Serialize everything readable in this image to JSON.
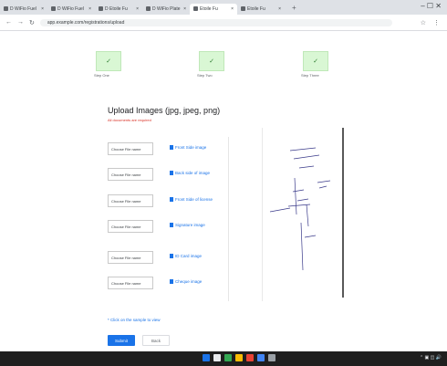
{
  "browser": {
    "tabs": [
      {
        "title": "D WiFio Fuel",
        "active": false
      },
      {
        "title": "D WiFio Fuel",
        "active": false
      },
      {
        "title": "D Etoile Fu",
        "active": false
      },
      {
        "title": "D WiFio Plate Fu",
        "active": false
      },
      {
        "title": "Etoile Fu",
        "active": true
      },
      {
        "title": "Etoile Fu",
        "active": false
      }
    ],
    "new_tab": "+",
    "window_controls": "– ☐ ✕",
    "url": "app.example.com/registrations/upload",
    "nav": {
      "back": "←",
      "forward": "→",
      "reload": "↻"
    }
  },
  "stepper": {
    "steps": [
      {
        "check": "✓",
        "label": "Step One"
      },
      {
        "check": "✓",
        "label": "Step Two"
      },
      {
        "check": "✓",
        "label": "Step Three"
      }
    ]
  },
  "upload": {
    "title": "Upload Images (jpg, jpeg, png)",
    "subtitle": "All documents are required",
    "rows": [
      {
        "file": "Choose File name",
        "sample": "Front Side image"
      },
      {
        "file": "Choose File name",
        "sample": "Back side of image"
      },
      {
        "file": "Choose File name",
        "sample": "Front Side of license"
      },
      {
        "file": "Choose File name",
        "sample": "Signature image"
      },
      {
        "file": "Choose File name",
        "sample": "ID Card image"
      },
      {
        "file": "Choose File name",
        "sample": "Cheque image"
      }
    ],
    "note": "* Click on the sample to view",
    "primary_button": "Submit",
    "secondary_button": "Back"
  },
  "colors": {
    "accent": "#1a73e8",
    "step_done": "#d9f7d4",
    "warning": "#d93025"
  }
}
